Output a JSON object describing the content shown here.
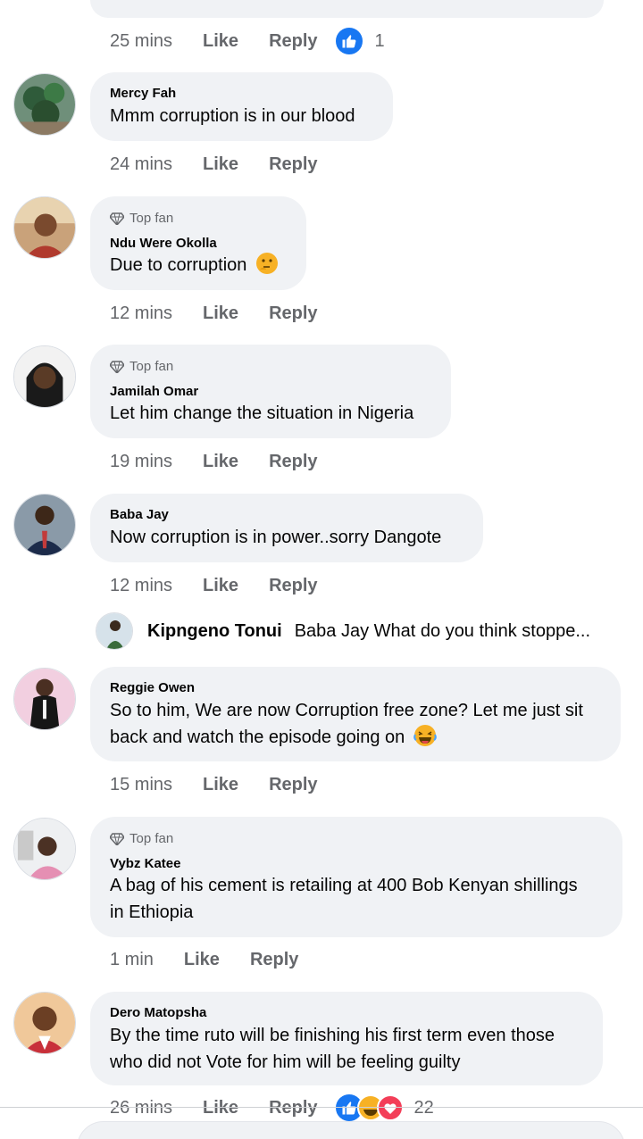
{
  "top_bubble_stub": "",
  "first_actions": {
    "time": "25 mins",
    "like": "Like",
    "reply": "Reply",
    "reaction_count": "1"
  },
  "comments": [
    {
      "name": "Mercy Fah",
      "badge": "",
      "text": "Mmm corruption is in our blood",
      "time": "24 mins",
      "like": "Like",
      "reply": "Reply"
    },
    {
      "name": "Ndu Were Okolla",
      "badge": "Top fan",
      "text": "Due to corruption",
      "emoji": "thinking-face-icon",
      "time": "12 mins",
      "like": "Like",
      "reply": "Reply"
    },
    {
      "name": "Jamilah Omar",
      "badge": "Top fan",
      "text": "Let him change the situation in Nigeria",
      "time": "19 mins",
      "like": "Like",
      "reply": "Reply"
    },
    {
      "name": "Baba Jay",
      "badge": "",
      "text": "Now corruption is in power..sorry Dangote",
      "time": "12 mins",
      "like": "Like",
      "reply": "Reply"
    },
    {
      "name": "Reggie Owen",
      "badge": "",
      "text_line1": "So to him, We are now Corruption free zone? Let me just sit",
      "text_line2": "back and watch the episode going on",
      "emoji": "laughing-crying-face-icon",
      "time": "15 mins",
      "like": "Like",
      "reply": "Reply"
    },
    {
      "name": "Vybz Katee",
      "badge": "Top fan",
      "text_line1": "A bag of his cement is retailing at 400 Bob Kenyan shillings",
      "text_line2": "in Ethiopia",
      "time": "1 min",
      "like": "Like",
      "reply": "Reply"
    },
    {
      "name": "Dero Matopsha",
      "badge": "",
      "text_line1": "By the time ruto will be finishing his first term even those",
      "text_line2": "who did not Vote for him will be feeling guilty",
      "time": "26 mins",
      "like": "Like",
      "reply": "Reply",
      "reaction_count": "22"
    }
  ],
  "nested_reply": {
    "name": "Kipngeno Tonui",
    "text": "Baba Jay What do you think stoppe..."
  },
  "colors": {
    "bubble": "#f0f2f5",
    "secondary_text": "#65676b",
    "like_blue": "#1877f2",
    "love_red": "#f33e58",
    "haha_yellow": "#f7b125"
  }
}
